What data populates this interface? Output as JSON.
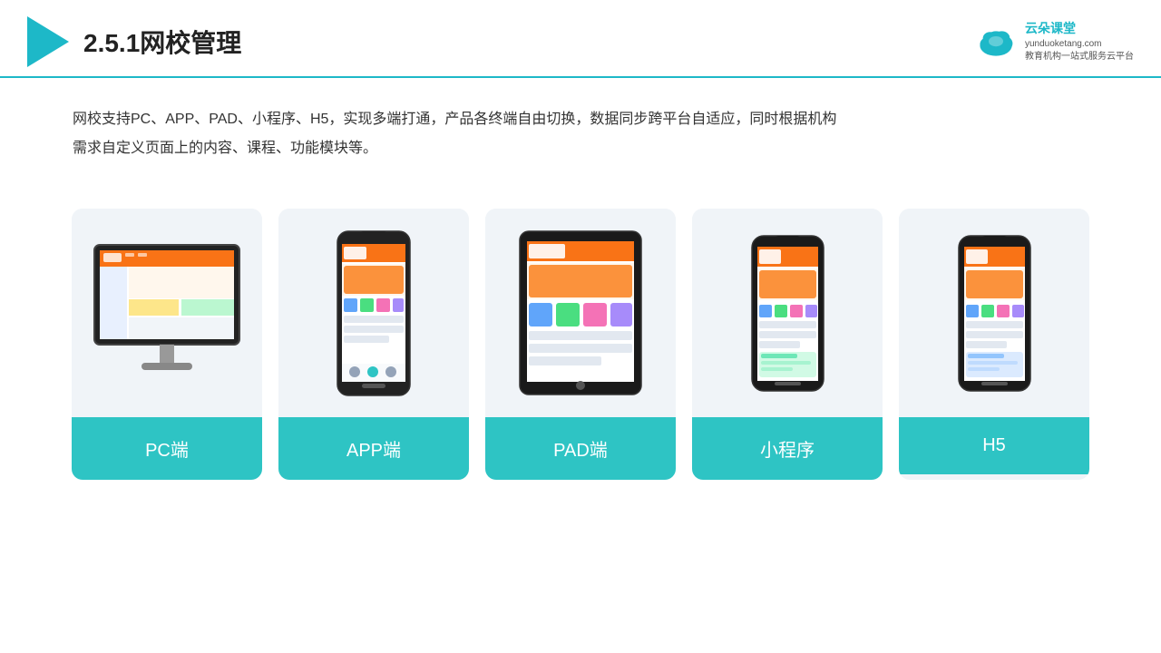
{
  "header": {
    "title": "2.5.1网校管理",
    "logo_name": "云朵课堂",
    "logo_sub": "yunduoketang.com",
    "logo_tagline": "教育机构一站\n式服务云平台"
  },
  "description": {
    "text_line1": "网校支持PC、APP、PAD、小程序、H5，实现多端打通，产品各终端自由切换，数据同步跨平台自适应，同时根据机构",
    "text_line2": "需求自定义页面上的内容、课程、功能模块等。"
  },
  "cards": [
    {
      "id": "pc",
      "label": "PC端",
      "color": "#2ec4c4"
    },
    {
      "id": "app",
      "label": "APP端",
      "color": "#2ec4c4"
    },
    {
      "id": "pad",
      "label": "PAD端",
      "color": "#2ec4c4"
    },
    {
      "id": "miniapp",
      "label": "小程序",
      "color": "#2ec4c4"
    },
    {
      "id": "h5",
      "label": "H5",
      "color": "#2ec4c4"
    }
  ],
  "accent_color": "#1db8c8"
}
